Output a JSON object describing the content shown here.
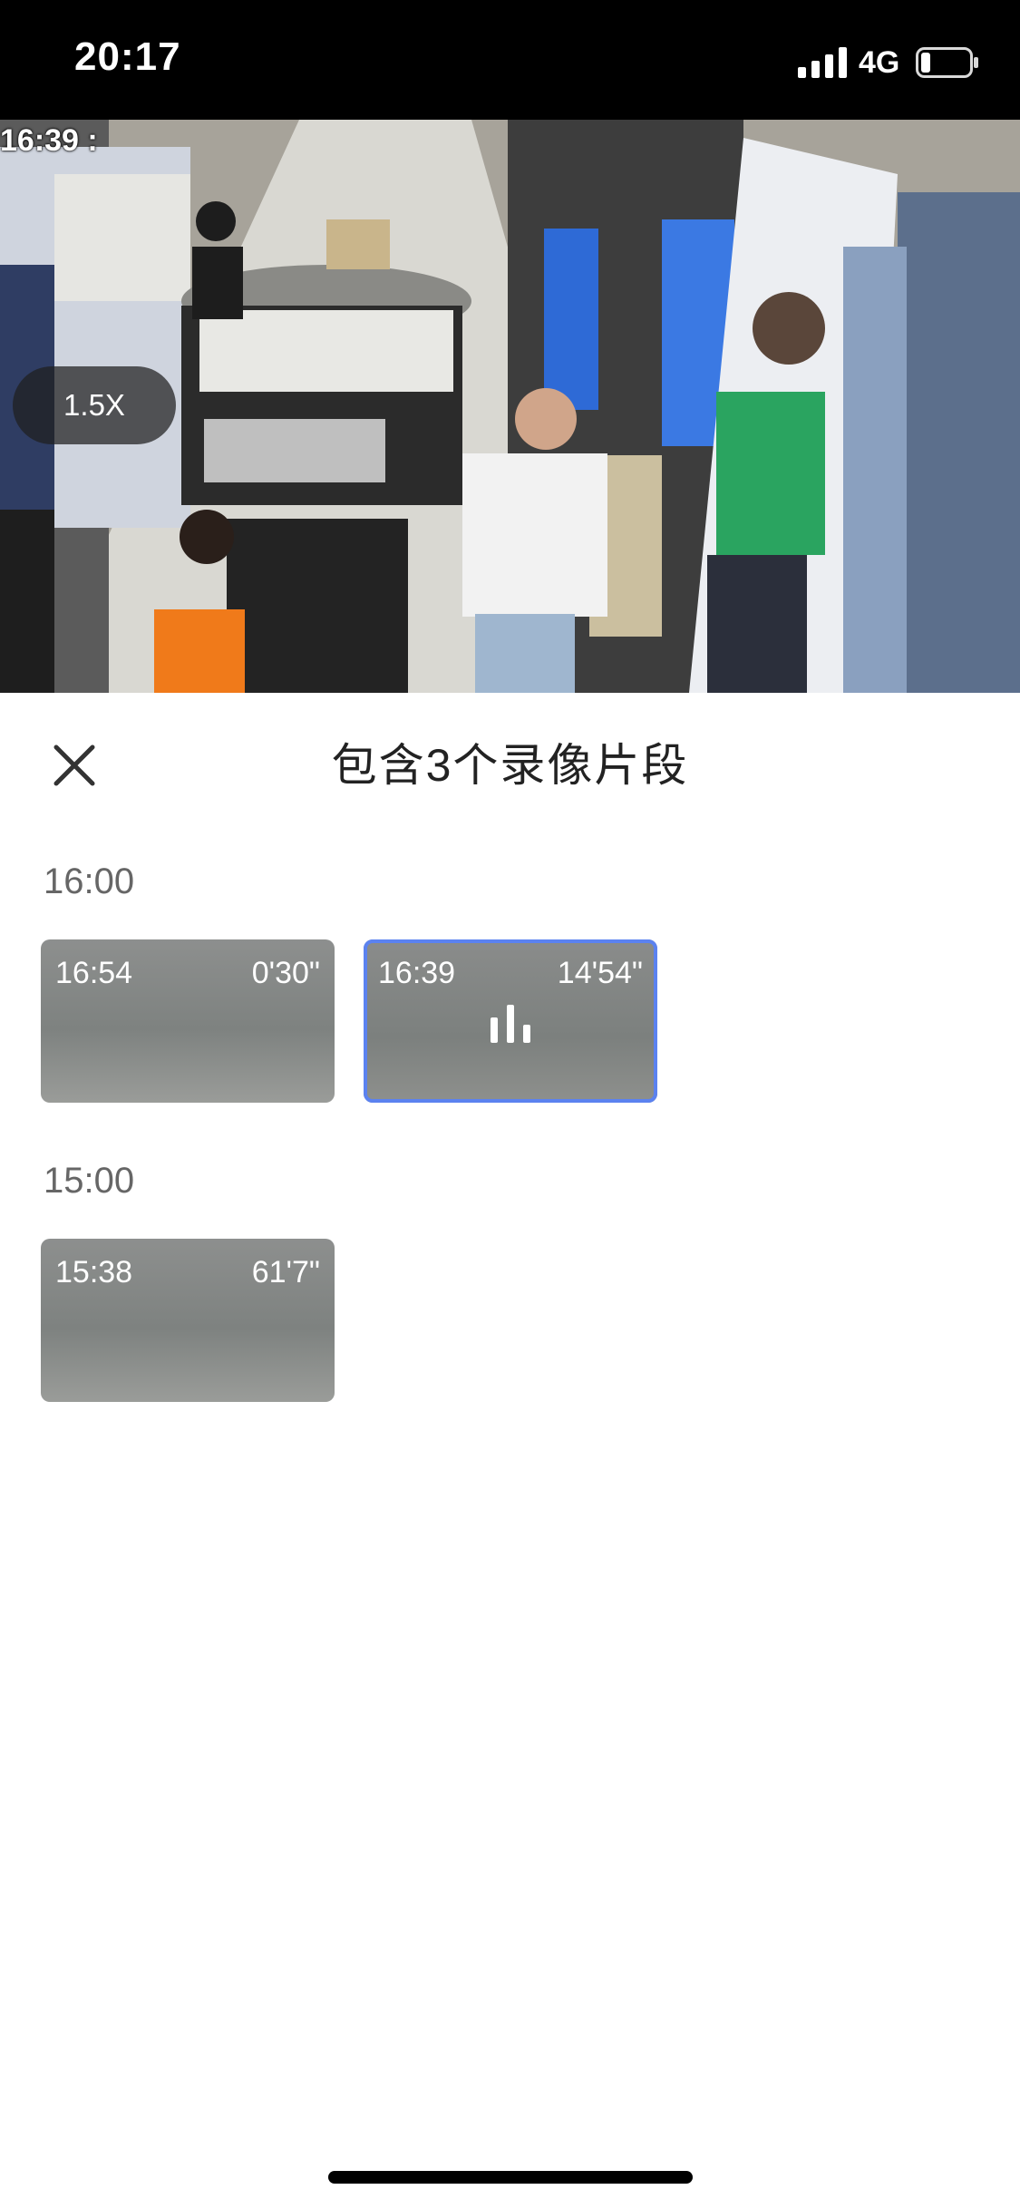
{
  "status_bar": {
    "time": "20:17",
    "network": "4G",
    "icons": [
      "signal-icon",
      "battery-icon"
    ]
  },
  "video": {
    "overlay_timestamp": "16:39 :",
    "speed": "1.5X"
  },
  "sheet": {
    "title": "包含3个录像片段",
    "close_icon": "close-icon",
    "groups": [
      {
        "label": "16:00",
        "clips": [
          {
            "start": "16:54",
            "duration": "0'30\"",
            "selected": false
          },
          {
            "start": "16:39",
            "duration": "14'54\"",
            "selected": true
          }
        ]
      },
      {
        "label": "15:00",
        "clips": [
          {
            "start": "15:38",
            "duration": "61'7\"",
            "selected": false
          }
        ]
      }
    ]
  },
  "colors": {
    "accent": "#5b82f0",
    "status_bar_bg": "#000000",
    "clip_bg": "#858886"
  }
}
